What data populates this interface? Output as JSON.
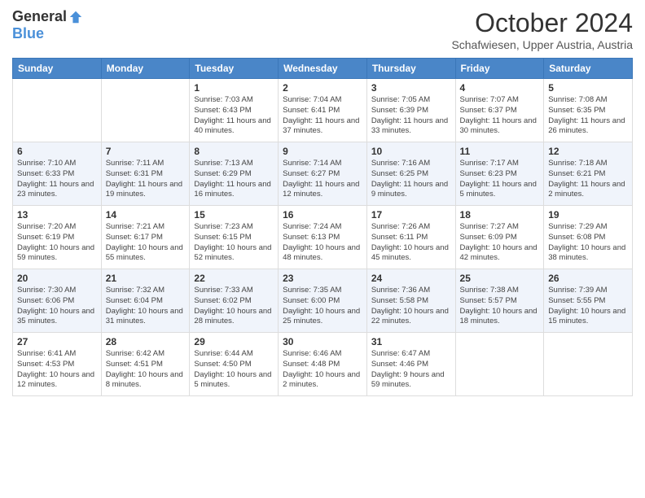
{
  "header": {
    "logo_general": "General",
    "logo_blue": "Blue",
    "month_title": "October 2024",
    "location": "Schafwiesen, Upper Austria, Austria"
  },
  "days_of_week": [
    "Sunday",
    "Monday",
    "Tuesday",
    "Wednesday",
    "Thursday",
    "Friday",
    "Saturday"
  ],
  "weeks": [
    [
      {
        "day": "",
        "info": ""
      },
      {
        "day": "",
        "info": ""
      },
      {
        "day": "1",
        "info": "Sunrise: 7:03 AM\nSunset: 6:43 PM\nDaylight: 11 hours and 40 minutes."
      },
      {
        "day": "2",
        "info": "Sunrise: 7:04 AM\nSunset: 6:41 PM\nDaylight: 11 hours and 37 minutes."
      },
      {
        "day": "3",
        "info": "Sunrise: 7:05 AM\nSunset: 6:39 PM\nDaylight: 11 hours and 33 minutes."
      },
      {
        "day": "4",
        "info": "Sunrise: 7:07 AM\nSunset: 6:37 PM\nDaylight: 11 hours and 30 minutes."
      },
      {
        "day": "5",
        "info": "Sunrise: 7:08 AM\nSunset: 6:35 PM\nDaylight: 11 hours and 26 minutes."
      }
    ],
    [
      {
        "day": "6",
        "info": "Sunrise: 7:10 AM\nSunset: 6:33 PM\nDaylight: 11 hours and 23 minutes."
      },
      {
        "day": "7",
        "info": "Sunrise: 7:11 AM\nSunset: 6:31 PM\nDaylight: 11 hours and 19 minutes."
      },
      {
        "day": "8",
        "info": "Sunrise: 7:13 AM\nSunset: 6:29 PM\nDaylight: 11 hours and 16 minutes."
      },
      {
        "day": "9",
        "info": "Sunrise: 7:14 AM\nSunset: 6:27 PM\nDaylight: 11 hours and 12 minutes."
      },
      {
        "day": "10",
        "info": "Sunrise: 7:16 AM\nSunset: 6:25 PM\nDaylight: 11 hours and 9 minutes."
      },
      {
        "day": "11",
        "info": "Sunrise: 7:17 AM\nSunset: 6:23 PM\nDaylight: 11 hours and 5 minutes."
      },
      {
        "day": "12",
        "info": "Sunrise: 7:18 AM\nSunset: 6:21 PM\nDaylight: 11 hours and 2 minutes."
      }
    ],
    [
      {
        "day": "13",
        "info": "Sunrise: 7:20 AM\nSunset: 6:19 PM\nDaylight: 10 hours and 59 minutes."
      },
      {
        "day": "14",
        "info": "Sunrise: 7:21 AM\nSunset: 6:17 PM\nDaylight: 10 hours and 55 minutes."
      },
      {
        "day": "15",
        "info": "Sunrise: 7:23 AM\nSunset: 6:15 PM\nDaylight: 10 hours and 52 minutes."
      },
      {
        "day": "16",
        "info": "Sunrise: 7:24 AM\nSunset: 6:13 PM\nDaylight: 10 hours and 48 minutes."
      },
      {
        "day": "17",
        "info": "Sunrise: 7:26 AM\nSunset: 6:11 PM\nDaylight: 10 hours and 45 minutes."
      },
      {
        "day": "18",
        "info": "Sunrise: 7:27 AM\nSunset: 6:09 PM\nDaylight: 10 hours and 42 minutes."
      },
      {
        "day": "19",
        "info": "Sunrise: 7:29 AM\nSunset: 6:08 PM\nDaylight: 10 hours and 38 minutes."
      }
    ],
    [
      {
        "day": "20",
        "info": "Sunrise: 7:30 AM\nSunset: 6:06 PM\nDaylight: 10 hours and 35 minutes."
      },
      {
        "day": "21",
        "info": "Sunrise: 7:32 AM\nSunset: 6:04 PM\nDaylight: 10 hours and 31 minutes."
      },
      {
        "day": "22",
        "info": "Sunrise: 7:33 AM\nSunset: 6:02 PM\nDaylight: 10 hours and 28 minutes."
      },
      {
        "day": "23",
        "info": "Sunrise: 7:35 AM\nSunset: 6:00 PM\nDaylight: 10 hours and 25 minutes."
      },
      {
        "day": "24",
        "info": "Sunrise: 7:36 AM\nSunset: 5:58 PM\nDaylight: 10 hours and 22 minutes."
      },
      {
        "day": "25",
        "info": "Sunrise: 7:38 AM\nSunset: 5:57 PM\nDaylight: 10 hours and 18 minutes."
      },
      {
        "day": "26",
        "info": "Sunrise: 7:39 AM\nSunset: 5:55 PM\nDaylight: 10 hours and 15 minutes."
      }
    ],
    [
      {
        "day": "27",
        "info": "Sunrise: 6:41 AM\nSunset: 4:53 PM\nDaylight: 10 hours and 12 minutes."
      },
      {
        "day": "28",
        "info": "Sunrise: 6:42 AM\nSunset: 4:51 PM\nDaylight: 10 hours and 8 minutes."
      },
      {
        "day": "29",
        "info": "Sunrise: 6:44 AM\nSunset: 4:50 PM\nDaylight: 10 hours and 5 minutes."
      },
      {
        "day": "30",
        "info": "Sunrise: 6:46 AM\nSunset: 4:48 PM\nDaylight: 10 hours and 2 minutes."
      },
      {
        "day": "31",
        "info": "Sunrise: 6:47 AM\nSunset: 4:46 PM\nDaylight: 9 hours and 59 minutes."
      },
      {
        "day": "",
        "info": ""
      },
      {
        "day": "",
        "info": ""
      }
    ]
  ]
}
